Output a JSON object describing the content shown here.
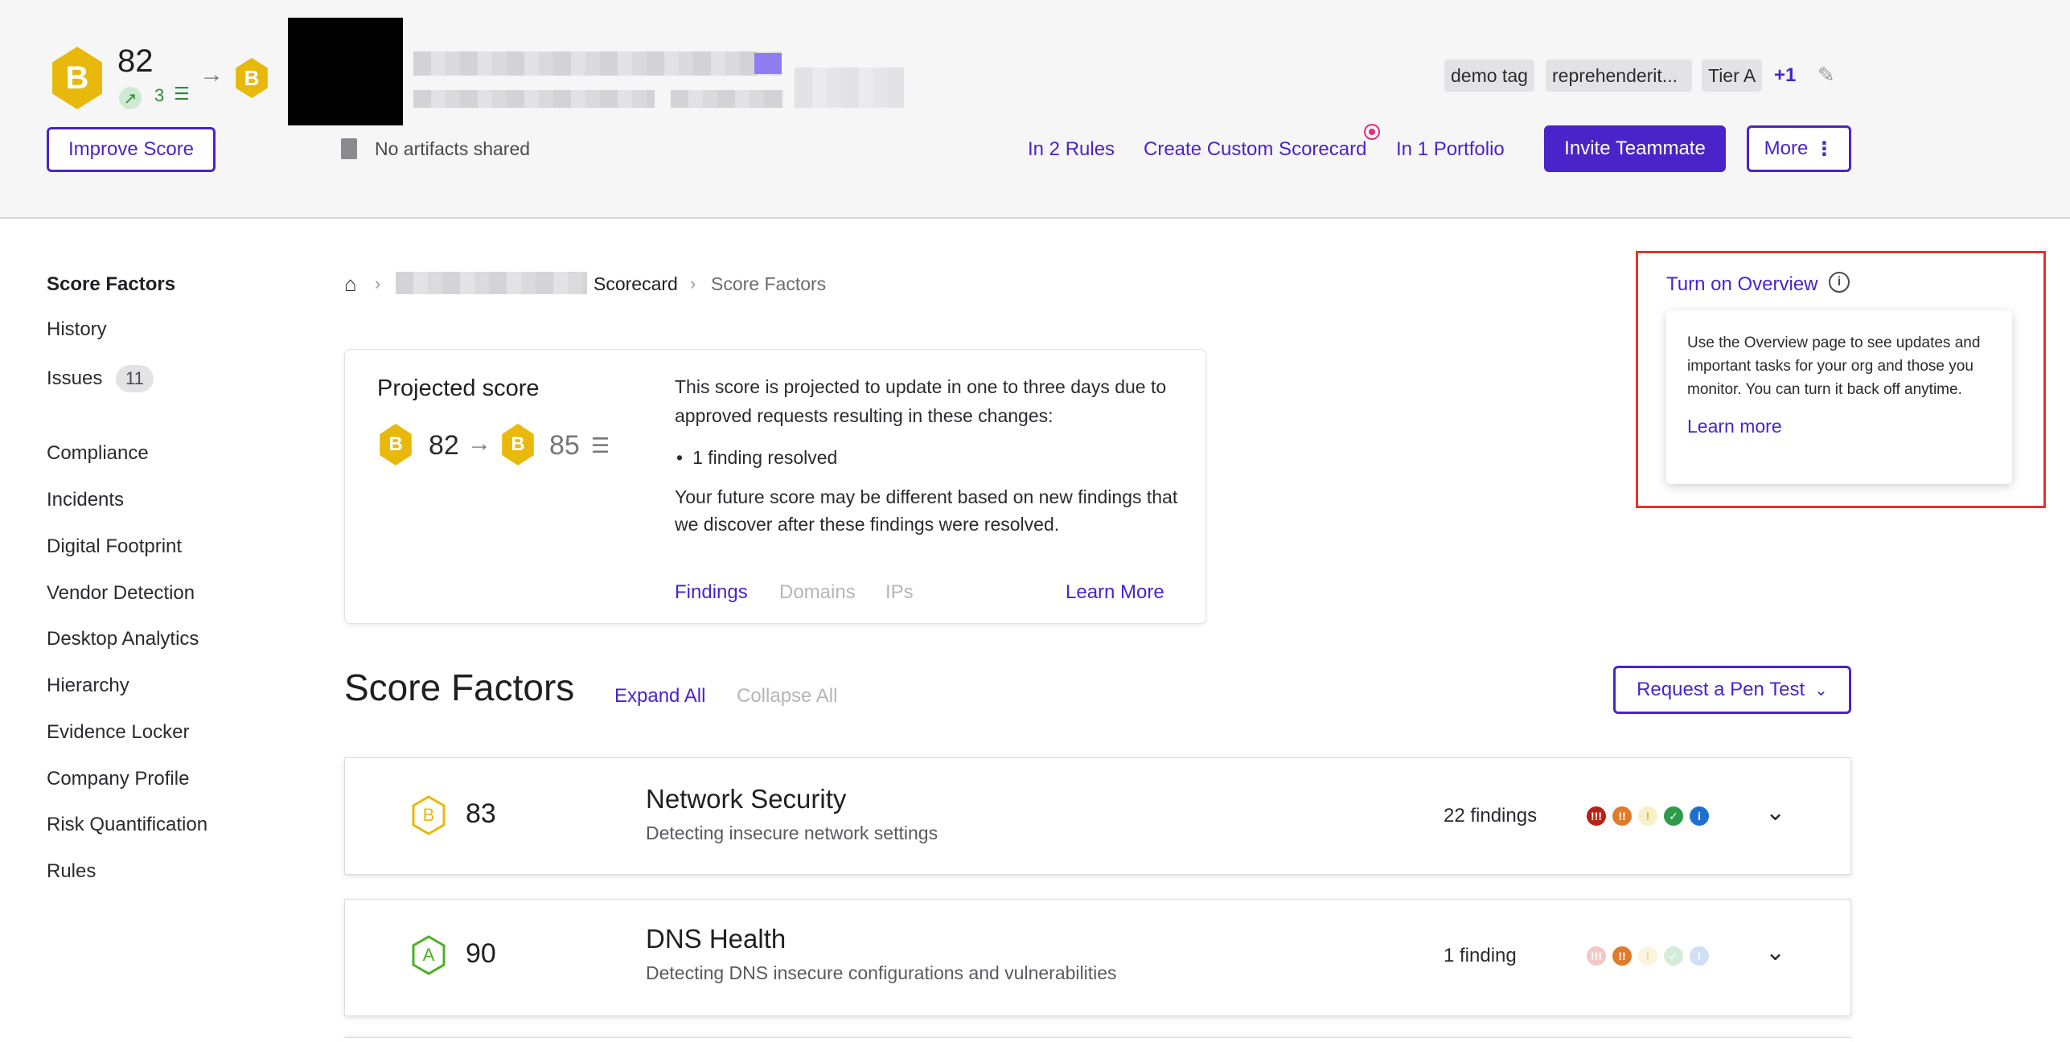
{
  "header": {
    "grade": "B",
    "score": "82",
    "trend_count": "3",
    "projected_grade": "B",
    "improve_button": "Improve Score",
    "artifacts_text": "No artifacts shared",
    "tags": [
      "demo tag",
      "reprehenderit...",
      "Tier A"
    ],
    "tags_more": "+1",
    "rules_link": "In 2 Rules",
    "custom_scorecard_link": "Create Custom Scorecard",
    "portfolio_link": "In 1 Portfolio",
    "invite_button": "Invite Teammate",
    "more_button": "More"
  },
  "sidebar": {
    "items": [
      {
        "label": "Score Factors"
      },
      {
        "label": "History"
      },
      {
        "label": "Issues",
        "badge": "11"
      },
      {
        "label": "Compliance"
      },
      {
        "label": "Incidents"
      },
      {
        "label": "Digital Footprint"
      },
      {
        "label": "Vendor Detection"
      },
      {
        "label": "Desktop Analytics"
      },
      {
        "label": "Hierarchy"
      },
      {
        "label": "Evidence Locker"
      },
      {
        "label": "Company Profile"
      },
      {
        "label": "Risk Quantification"
      },
      {
        "label": "Rules"
      }
    ]
  },
  "breadcrumb": {
    "scorecard": "Scorecard",
    "current": "Score Factors"
  },
  "overview": {
    "toggle_label": "Turn on Overview",
    "popover_text": "Use the Overview page to see updates and important tasks for your org and those you monitor. You can turn it back off anytime.",
    "learn_more": "Learn more"
  },
  "projected": {
    "title": "Projected score",
    "current_grade": "B",
    "current_score": "82",
    "new_grade": "B",
    "new_score": "85",
    "description": "This score is projected to update in one to three days due to approved requests resulting in these changes:",
    "bullet": "1 finding resolved",
    "note": "Your future score may be different based on new findings that we discover after these findings were resolved.",
    "tabs": [
      "Findings",
      "Domains",
      "IPs"
    ],
    "learn_more": "Learn More"
  },
  "score_factors": {
    "heading": "Score Factors",
    "expand_all": "Expand All",
    "collapse_all": "Collapse All",
    "pen_test_button": "Request a Pen Test",
    "rows": [
      {
        "grade": "B",
        "score": "83",
        "title": "Network Security",
        "subtitle": "Detecting insecure network settings",
        "findings": "22 findings",
        "grade_color": "#e8b90b"
      },
      {
        "grade": "A",
        "score": "90",
        "title": "DNS Health",
        "subtitle": "Detecting DNS insecure configurations and vulnerabilities",
        "findings": "1 finding",
        "grade_color": "#4caf24"
      }
    ]
  },
  "colors": {
    "accent": "#4a24c9",
    "grade_b": "#e8b90b",
    "grade_a": "#4caf24",
    "highlight_box": "#e5332a"
  }
}
